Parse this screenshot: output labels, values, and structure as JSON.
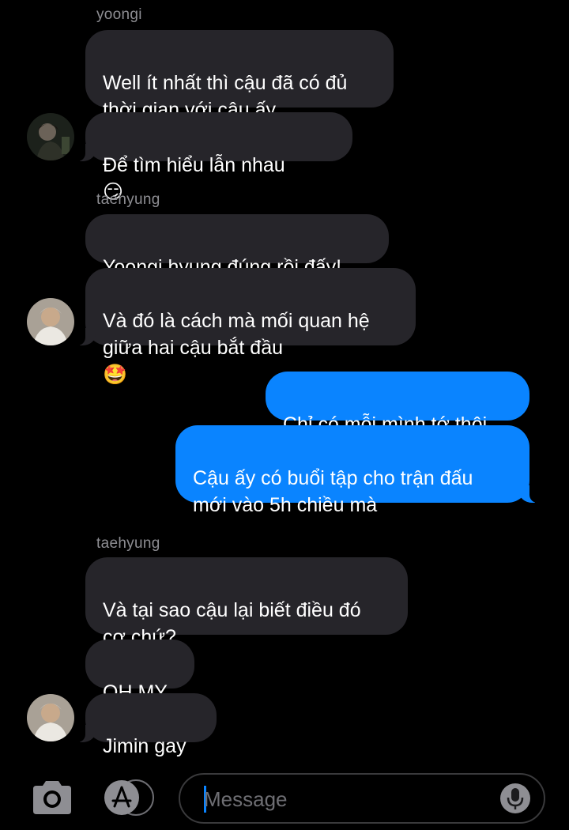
{
  "messages": [
    {
      "sender": "yoongi",
      "bubbles": [
        {
          "text": "Well ít nhất thì cậu đã có đủ\nthời gian với cậu ấy"
        },
        {
          "text": "Để tìm hiểu lẫn nhau",
          "emoji": "😏"
        }
      ]
    },
    {
      "sender": "taehyung",
      "bubbles": [
        {
          "text": "Yoongi hyung đúng rồi đấy!"
        },
        {
          "text": "Và đó là cách mà mối quan hệ\ngiữa hai cậu bắt đầu",
          "emoji": "🤩"
        }
      ]
    },
    {
      "sender": "me",
      "bubbles": [
        {
          "text": "Chỉ có mỗi mình tớ thôi"
        },
        {
          "text": "Cậu ấy có buổi tập cho trận đấu\nmới vào 5h chiều mà"
        }
      ]
    },
    {
      "sender": "taehyung",
      "bubbles": [
        {
          "text": "Và tại sao cậu lại biết điều đó\ncơ chứ?",
          "emoji": "😏"
        },
        {
          "text": "OH MY"
        },
        {
          "text": "Jimin gay"
        }
      ]
    }
  ],
  "sender_labels": {
    "yoongi": "yoongi",
    "taehyung_1": "taehyung",
    "taehyung_2": "taehyung"
  },
  "composer": {
    "placeholder": "Message",
    "value": ""
  },
  "icons": {
    "camera": "camera-icon",
    "apps": "app-store-icon",
    "mic": "microphone-icon"
  },
  "colors": {
    "incoming": "#26252a",
    "outgoing": "#0a84ff",
    "background": "#000000",
    "sender": "#8e8e93"
  }
}
